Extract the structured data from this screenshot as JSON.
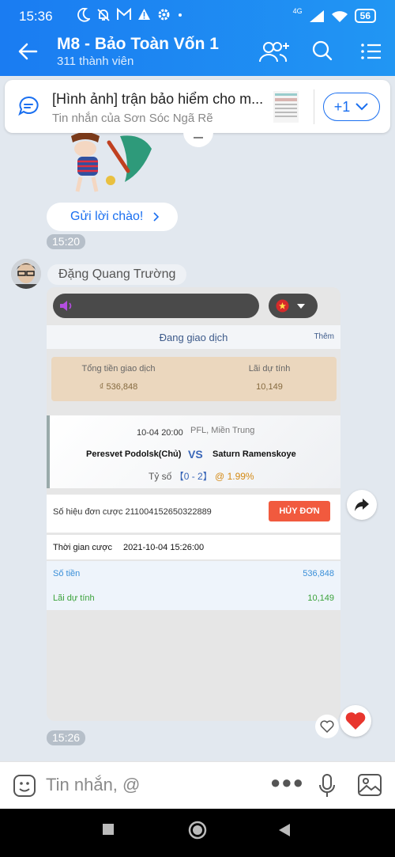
{
  "status_bar": {
    "time": "15:36",
    "network": "4G",
    "battery": "56"
  },
  "header": {
    "title": "M8 - Bảo Toàn Vốn 1",
    "subtitle": "311 thành viên"
  },
  "pinned": {
    "title": "[Hình ảnh] trận bảo hiểm cho m...",
    "subtitle": "Tin nhắn của Sơn Sóc  Ngã Rẽ",
    "count": "+1"
  },
  "greeting": {
    "label": "Gửi lời chào!"
  },
  "timestamps": {
    "first": "15:20",
    "second": "15:26"
  },
  "sender": {
    "name": "Đặng Quang Trường"
  },
  "bet_screenshot": {
    "header": "Đang giao dịch",
    "more": "Thêm",
    "total_label": "Tổng tiền giao dịch",
    "total_value": "₫ 536,848",
    "profit_label": "Lãi dự tính",
    "profit_value": "10,149",
    "match_datetime": "10-04 20:00",
    "league": "PFL, Miền Trung",
    "home_team": "Peresvet Podolsk(Chủ)",
    "vs": "VS",
    "away_team": "Saturn Ramenskoye",
    "score_label": "Tỷ số",
    "score": "【0 - 2】",
    "odds": "@ 1.99%",
    "order_label": "Số hiệu đơn cược 211004152650322889",
    "cancel_label": "HỦY ĐƠN",
    "time_label": "Thời gian cược",
    "time_value": "2021-10-04 15:26:00",
    "amount_label": "Số tiền",
    "amount_value": "536,848",
    "expected_label": "Lãi dự tính",
    "expected_value": "10,149"
  },
  "composer": {
    "placeholder": "Tin nhắn, @"
  },
  "colors": {
    "primary": "#1a7cf2",
    "cancel": "#f15a3e",
    "heart": "#e8352d"
  }
}
